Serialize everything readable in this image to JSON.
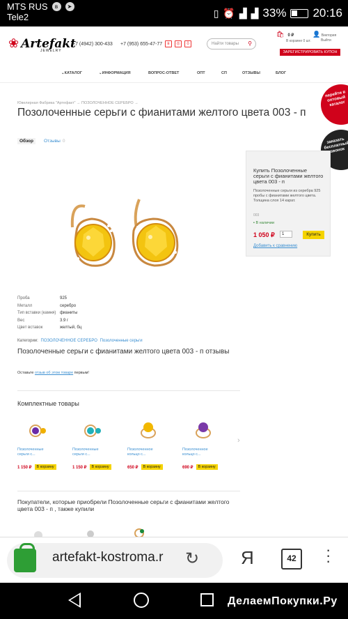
{
  "statusbar": {
    "carrier1": "MTS RUS",
    "carrier2": "Tele2",
    "battery": "33%",
    "time": "20:16"
  },
  "header": {
    "logo": "Artefakt",
    "logo_sub": "JEWELRY",
    "phone1": "+7 (4942) 300-433",
    "phone2": "+7 (953) 655-47-77",
    "social": [
      "в",
      "◎",
      "ö"
    ],
    "search_placeholder": "Найти товары",
    "cart_sum": "0 ₽",
    "cart_sub": "В корзине 0 шт.",
    "user_name": "Виктория",
    "user_logout": "Выйти",
    "register_button": "ЗАРЕГИСТРИРОВАТЬ КУПОН"
  },
  "nav": {
    "items": [
      "КАТАЛОГ",
      "ИНФОРМАЦИЯ",
      "ВОПРОС-ОТВЕТ",
      "ОПТ",
      "СП",
      "ОТЗЫВЫ",
      "БЛОГ"
    ]
  },
  "breadcrumb": {
    "item1": "Ювелирная Фабрика \"Артефакт\"",
    "item2": "ПОЗОЛОЧЕННОЕ СЕРЕБРО"
  },
  "product": {
    "title": "Позолоченные серьги с фианитами желтого цвета 003 - п",
    "tag": "Обзор",
    "reviews_label": "Отзывы",
    "reviews_count": "0"
  },
  "corner_badges": {
    "wholesale": "перейти в оптовый каталог",
    "callback": "заказать бесплатный звонок"
  },
  "buybox": {
    "title": "Купить Позолоченные серьги с фианитами желтого цвета 003 - п",
    "desc": "Позолоченные серьги из серебра 925 пробы с фианитами желтого цвета. Толщина слоя 14 карат.",
    "article": "003",
    "stock": "В наличии",
    "price": "1 050 ₽",
    "qty": "1",
    "buy_button": "Купить",
    "compare": "Добавить к сравнению"
  },
  "specs": [
    {
      "k": "Проба",
      "v": "925"
    },
    {
      "k": "Металл",
      "v": "серебро"
    },
    {
      "k": "Тип вставки (камня)",
      "v": "фианиты"
    },
    {
      "k": "Вес",
      "v": "3.9 г"
    },
    {
      "k": "Цвет вставок",
      "v": "желтый, бц"
    }
  ],
  "categories": {
    "label": "Категории:",
    "cat1": "ПОЗОЛОЧЕННОЕ СЕРЕБРО",
    "cat2": "Позолоченные серьги"
  },
  "reviews_section": {
    "title": "Позолоченные серьги с фианитами желтого цвета 003 - п отзывы",
    "leave_prefix": "Оставьте",
    "leave_link": "отзыв об этом товаре",
    "leave_suffix": "первым!"
  },
  "complete": {
    "title": "Комплектные товары",
    "items": [
      {
        "name": "Позолоченные серьги с...",
        "price": "1 150 ₽",
        "button": "В корзину",
        "stone": "#6a2aa8"
      },
      {
        "name": "Позолоченные серьги с...",
        "price": "1 150 ₽",
        "button": "В корзину",
        "stone": "#1fb0b8"
      },
      {
        "name": "Позолоченное кольцо с...",
        "price": "650 ₽",
        "button": "В корзину",
        "stone": "#f2b800"
      },
      {
        "name": "Позолоченное кольцо с...",
        "price": "690 ₽",
        "button": "В корзину",
        "stone": "#7a3aa8"
      }
    ]
  },
  "also_bought": "Покупатели, которые приобрели Позолоченные серьги с фианитами желтого цвета 003 - п , также купили",
  "browser": {
    "url": "artefakt-kostroma.r",
    "yandex": "Я",
    "tabs": "42"
  },
  "watermark": "ДелаемПокупки.Ру"
}
